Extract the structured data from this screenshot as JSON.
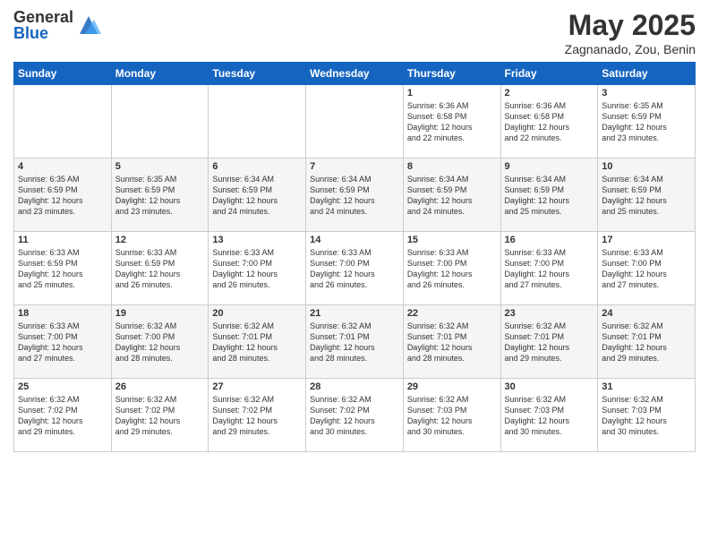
{
  "logo": {
    "general": "General",
    "blue": "Blue"
  },
  "title": "May 2025",
  "location": "Zagnanado, Zou, Benin",
  "days_of_week": [
    "Sunday",
    "Monday",
    "Tuesday",
    "Wednesday",
    "Thursday",
    "Friday",
    "Saturday"
  ],
  "weeks": [
    [
      {
        "day": "",
        "content": ""
      },
      {
        "day": "",
        "content": ""
      },
      {
        "day": "",
        "content": ""
      },
      {
        "day": "",
        "content": ""
      },
      {
        "day": "1",
        "content": "Sunrise: 6:36 AM\nSunset: 6:58 PM\nDaylight: 12 hours\nand 22 minutes."
      },
      {
        "day": "2",
        "content": "Sunrise: 6:36 AM\nSunset: 6:58 PM\nDaylight: 12 hours\nand 22 minutes."
      },
      {
        "day": "3",
        "content": "Sunrise: 6:35 AM\nSunset: 6:59 PM\nDaylight: 12 hours\nand 23 minutes."
      }
    ],
    [
      {
        "day": "4",
        "content": "Sunrise: 6:35 AM\nSunset: 6:59 PM\nDaylight: 12 hours\nand 23 minutes."
      },
      {
        "day": "5",
        "content": "Sunrise: 6:35 AM\nSunset: 6:59 PM\nDaylight: 12 hours\nand 23 minutes."
      },
      {
        "day": "6",
        "content": "Sunrise: 6:34 AM\nSunset: 6:59 PM\nDaylight: 12 hours\nand 24 minutes."
      },
      {
        "day": "7",
        "content": "Sunrise: 6:34 AM\nSunset: 6:59 PM\nDaylight: 12 hours\nand 24 minutes."
      },
      {
        "day": "8",
        "content": "Sunrise: 6:34 AM\nSunset: 6:59 PM\nDaylight: 12 hours\nand 24 minutes."
      },
      {
        "day": "9",
        "content": "Sunrise: 6:34 AM\nSunset: 6:59 PM\nDaylight: 12 hours\nand 25 minutes."
      },
      {
        "day": "10",
        "content": "Sunrise: 6:34 AM\nSunset: 6:59 PM\nDaylight: 12 hours\nand 25 minutes."
      }
    ],
    [
      {
        "day": "11",
        "content": "Sunrise: 6:33 AM\nSunset: 6:59 PM\nDaylight: 12 hours\nand 25 minutes."
      },
      {
        "day": "12",
        "content": "Sunrise: 6:33 AM\nSunset: 6:59 PM\nDaylight: 12 hours\nand 26 minutes."
      },
      {
        "day": "13",
        "content": "Sunrise: 6:33 AM\nSunset: 7:00 PM\nDaylight: 12 hours\nand 26 minutes."
      },
      {
        "day": "14",
        "content": "Sunrise: 6:33 AM\nSunset: 7:00 PM\nDaylight: 12 hours\nand 26 minutes."
      },
      {
        "day": "15",
        "content": "Sunrise: 6:33 AM\nSunset: 7:00 PM\nDaylight: 12 hours\nand 26 minutes."
      },
      {
        "day": "16",
        "content": "Sunrise: 6:33 AM\nSunset: 7:00 PM\nDaylight: 12 hours\nand 27 minutes."
      },
      {
        "day": "17",
        "content": "Sunrise: 6:33 AM\nSunset: 7:00 PM\nDaylight: 12 hours\nand 27 minutes."
      }
    ],
    [
      {
        "day": "18",
        "content": "Sunrise: 6:33 AM\nSunset: 7:00 PM\nDaylight: 12 hours\nand 27 minutes."
      },
      {
        "day": "19",
        "content": "Sunrise: 6:32 AM\nSunset: 7:00 PM\nDaylight: 12 hours\nand 28 minutes."
      },
      {
        "day": "20",
        "content": "Sunrise: 6:32 AM\nSunset: 7:01 PM\nDaylight: 12 hours\nand 28 minutes."
      },
      {
        "day": "21",
        "content": "Sunrise: 6:32 AM\nSunset: 7:01 PM\nDaylight: 12 hours\nand 28 minutes."
      },
      {
        "day": "22",
        "content": "Sunrise: 6:32 AM\nSunset: 7:01 PM\nDaylight: 12 hours\nand 28 minutes."
      },
      {
        "day": "23",
        "content": "Sunrise: 6:32 AM\nSunset: 7:01 PM\nDaylight: 12 hours\nand 29 minutes."
      },
      {
        "day": "24",
        "content": "Sunrise: 6:32 AM\nSunset: 7:01 PM\nDaylight: 12 hours\nand 29 minutes."
      }
    ],
    [
      {
        "day": "25",
        "content": "Sunrise: 6:32 AM\nSunset: 7:02 PM\nDaylight: 12 hours\nand 29 minutes."
      },
      {
        "day": "26",
        "content": "Sunrise: 6:32 AM\nSunset: 7:02 PM\nDaylight: 12 hours\nand 29 minutes."
      },
      {
        "day": "27",
        "content": "Sunrise: 6:32 AM\nSunset: 7:02 PM\nDaylight: 12 hours\nand 29 minutes."
      },
      {
        "day": "28",
        "content": "Sunrise: 6:32 AM\nSunset: 7:02 PM\nDaylight: 12 hours\nand 30 minutes."
      },
      {
        "day": "29",
        "content": "Sunrise: 6:32 AM\nSunset: 7:03 PM\nDaylight: 12 hours\nand 30 minutes."
      },
      {
        "day": "30",
        "content": "Sunrise: 6:32 AM\nSunset: 7:03 PM\nDaylight: 12 hours\nand 30 minutes."
      },
      {
        "day": "31",
        "content": "Sunrise: 6:32 AM\nSunset: 7:03 PM\nDaylight: 12 hours\nand 30 minutes."
      }
    ]
  ]
}
